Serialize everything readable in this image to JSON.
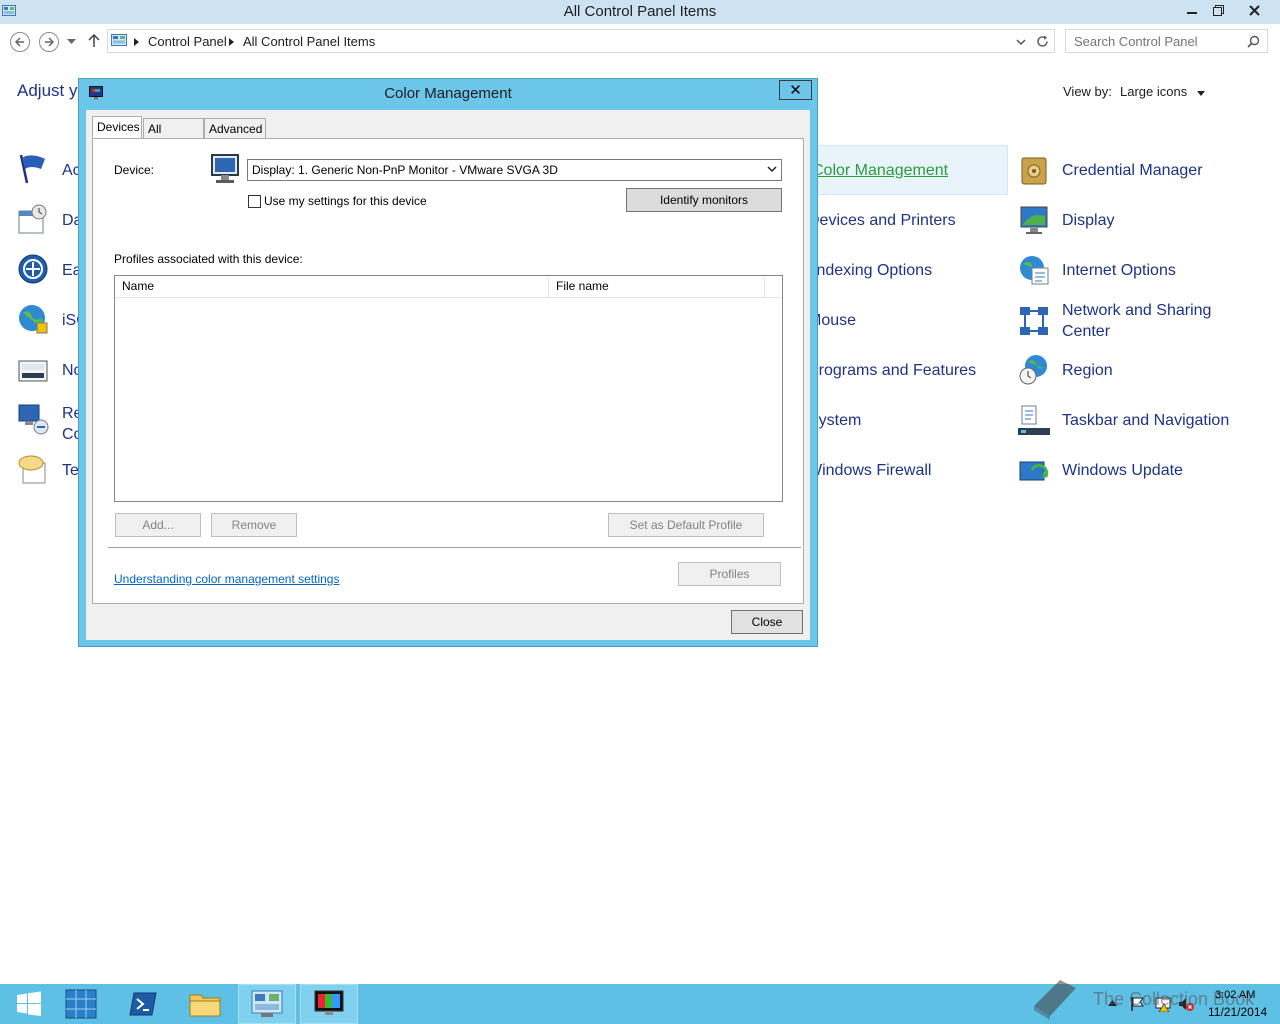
{
  "window": {
    "title": "All Control Panel Items",
    "breadcrumb": [
      "Control Panel",
      "All Control Panel Items"
    ],
    "search_placeholder": "Search Control Panel"
  },
  "header": {
    "adjust_text": "Adjust yo",
    "view_by_label": "View by:",
    "view_by_value": "Large icons"
  },
  "left_items": [
    {
      "label": "Ac",
      "icon": "action-center-flag-icon"
    },
    {
      "label": "Da",
      "icon": "date-time-icon"
    },
    {
      "label": "Ea",
      "icon": "ease-of-access-icon"
    },
    {
      "label": "iSC",
      "icon": "iscsi-globe-icon"
    },
    {
      "label": "No",
      "icon": "notification-icon"
    },
    {
      "label": "Re",
      "label2": "Co",
      "icon": "remote-connections-icon"
    },
    {
      "label": "Te",
      "icon": "text-speech-icon"
    }
  ],
  "mid_items": [
    {
      "label": "Color Management",
      "selected": true
    },
    {
      "label": "Devices and Printers"
    },
    {
      "label": "Indexing Options"
    },
    {
      "label": "Mouse"
    },
    {
      "label": "Programs and Features"
    },
    {
      "label": "System"
    },
    {
      "label": "Windows Firewall"
    }
  ],
  "right_items": [
    {
      "label": "Credential Manager",
      "icon": "credential-manager-icon"
    },
    {
      "label": "Display",
      "icon": "display-icon"
    },
    {
      "label": "Internet Options",
      "icon": "internet-options-icon"
    },
    {
      "label": "Network and Sharing",
      "label2": "Center",
      "icon": "network-icon"
    },
    {
      "label": "Region",
      "icon": "region-icon"
    },
    {
      "label": "Taskbar and Navigation",
      "icon": "taskbar-icon"
    },
    {
      "label": "Windows Update",
      "icon": "windows-update-icon"
    }
  ],
  "dialog": {
    "title": "Color Management",
    "close_glyph": "✕",
    "tabs": [
      "Devices",
      "All Profiles",
      "Advanced"
    ],
    "device_label": "Device:",
    "device_value": "Display: 1. Generic Non-PnP Monitor - VMware SVGA 3D",
    "use_my_settings": "Use my settings for this device",
    "identify_monitors": "Identify monitors",
    "profiles_label": "Profiles associated with this device:",
    "columns": [
      "Name",
      "File name"
    ],
    "add_button": "Add...",
    "remove_button": "Remove",
    "set_default_button": "Set as Default Profile",
    "link": "Understanding color management settings",
    "profiles_button": "Profiles",
    "close_button": "Close"
  },
  "taskbar": {
    "time": "3:02 AM",
    "date": "11/21/2014",
    "watermark": "The Collection Book"
  },
  "colors": {
    "link_blue": "#1e3287",
    "accent": "#5fc0e6",
    "dialog_frame": "#6bc6e9"
  }
}
